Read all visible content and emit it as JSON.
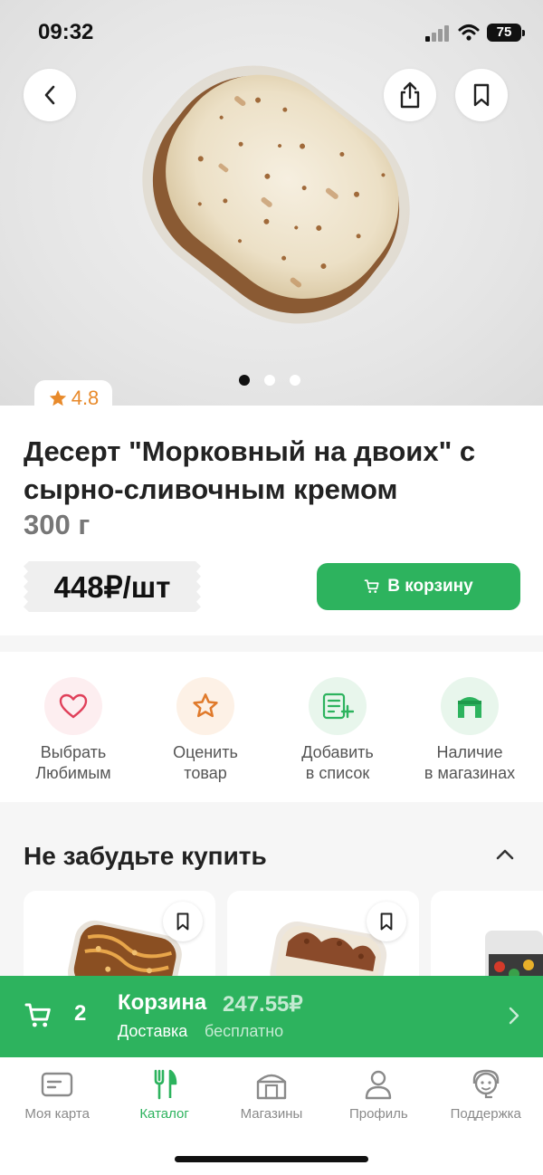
{
  "status": {
    "time": "09:32",
    "battery": "75"
  },
  "product": {
    "rating": "4.8",
    "title": "Десерт \"Морковный на двоих\" с сырно-сливочным кремом",
    "weight": "300 г",
    "price": "448₽/шт",
    "add_to_cart": "В корзину",
    "gallery": {
      "count": 3,
      "active_index": 0
    }
  },
  "actions": [
    {
      "label": "Выбрать\nЛюбимым",
      "icon": "heart-icon",
      "bg": "#fdeef0",
      "color": "#e0405a"
    },
    {
      "label": "Оценить\nтовар",
      "icon": "star-outline-icon",
      "bg": "#fdf1e6",
      "color": "#e07a2b"
    },
    {
      "label": "Добавить\nв список",
      "icon": "list-add-icon",
      "bg": "#e8f6ec",
      "color": "#2db35e"
    },
    {
      "label": "Наличие\nв магазинах",
      "icon": "store-icon",
      "bg": "#e8f6ec",
      "color": "#2db35e"
    }
  ],
  "section": {
    "title": "Не забудьте купить"
  },
  "basket": {
    "count": "2",
    "title": "Корзина",
    "total": "247.55₽",
    "delivery_label": "Доставка",
    "delivery_value": "бесплатно"
  },
  "tabs": [
    {
      "label": "Моя карта",
      "icon": "card-icon",
      "active": false
    },
    {
      "label": "Каталог",
      "icon": "fork-knife-icon",
      "active": true
    },
    {
      "label": "Магазины",
      "icon": "store-icon",
      "active": false
    },
    {
      "label": "Профиль",
      "icon": "profile-icon",
      "active": false
    },
    {
      "label": "Поддержка",
      "icon": "support-icon",
      "active": false
    }
  ],
  "colors": {
    "accent": "#2db35e",
    "rating": "#e88a2b"
  }
}
